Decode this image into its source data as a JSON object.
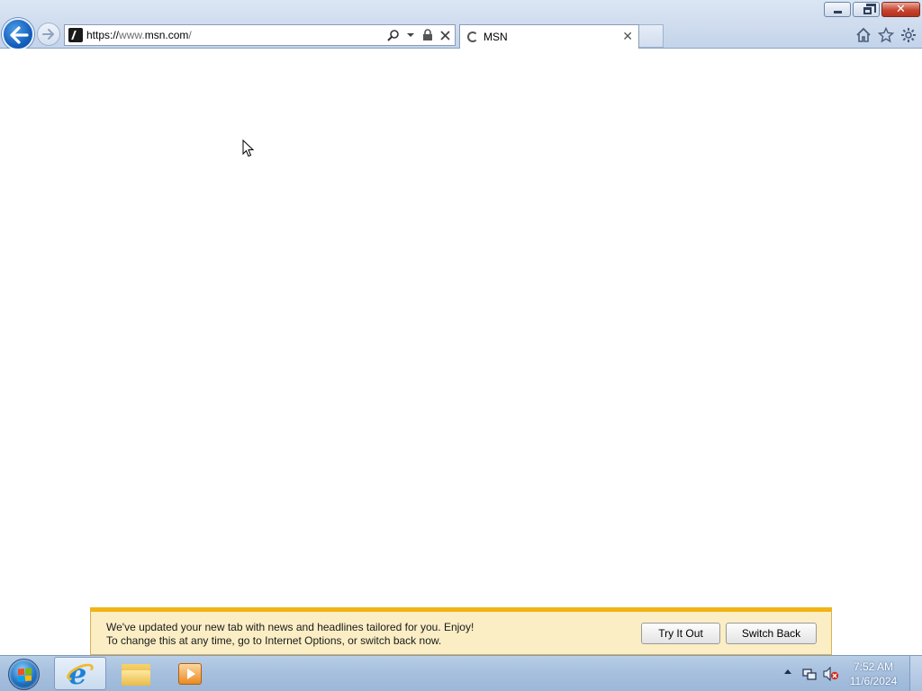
{
  "browser": {
    "address": {
      "scheme": "https://",
      "host_prefix": "www.",
      "host": "msn.com",
      "path": "/"
    },
    "tab": {
      "title": "MSN"
    }
  },
  "notification": {
    "line1": "We've updated your new tab with news and headlines tailored for you. Enjoy!",
    "line2": "To change this at any time, go to Internet Options, or switch back now.",
    "try_label": "Try It Out",
    "switch_label": "Switch Back"
  },
  "taskbar": {
    "items": [
      "internet-explorer",
      "windows-explorer",
      "windows-media-player"
    ],
    "clock": {
      "time": "7:52 AM",
      "date": "11/6/2024"
    }
  },
  "colors": {
    "notify_bg": "#fbeec5",
    "notify_accent": "#f2b316",
    "back_button": "#1560bd",
    "close_button": "#c7452f"
  }
}
